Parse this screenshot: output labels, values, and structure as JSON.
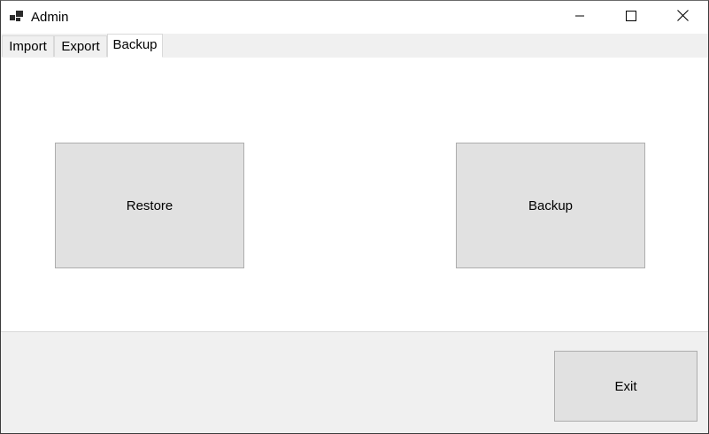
{
  "window": {
    "title": "Admin",
    "icon": "app-windows-icon"
  },
  "caption_buttons": {
    "minimize_icon": "minimize-icon",
    "maximize_icon": "maximize-icon",
    "close_icon": "close-icon"
  },
  "tabs": [
    {
      "label": "Import",
      "selected": false
    },
    {
      "label": "Export",
      "selected": false
    },
    {
      "label": "Backup",
      "selected": true
    }
  ],
  "backup_page": {
    "restore_label": "Restore",
    "backup_label": "Backup"
  },
  "footer": {
    "exit_label": "Exit"
  },
  "colors": {
    "button_face": "#e1e1e1",
    "panel_background": "#f0f0f0",
    "button_border": "#adadad"
  }
}
